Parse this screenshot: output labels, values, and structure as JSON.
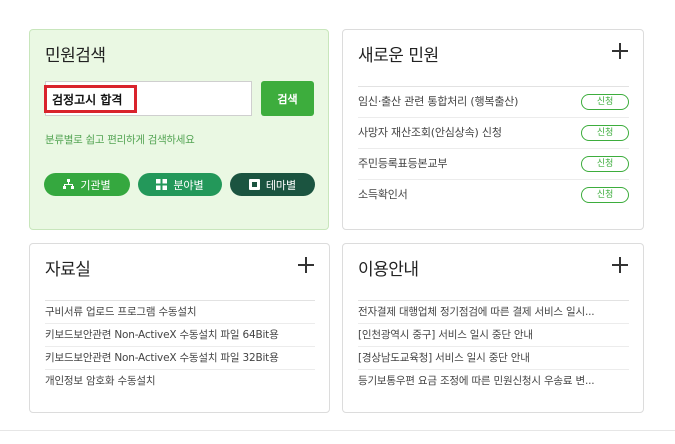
{
  "search": {
    "title": "민원검색",
    "input_value": "검정고시 합격",
    "button_label": "검색",
    "hint": "분류별로 쉽고 편리하게 검색하세요",
    "filters": [
      {
        "label": "기관별",
        "icon": "org-chart-icon"
      },
      {
        "label": "분야별",
        "icon": "grid-icon"
      },
      {
        "label": "테마별",
        "icon": "theme-icon"
      }
    ]
  },
  "new_services": {
    "title": "새로운 민원",
    "items": [
      {
        "label": "임신·출산 관련 통합처리 (행복출산)",
        "badge": "신청"
      },
      {
        "label": "사망자 재산조회(안심상속) 신청",
        "badge": "신청"
      },
      {
        "label": "주민등록표등본교부",
        "badge": "신청"
      },
      {
        "label": "소득확인서",
        "badge": "신청"
      }
    ]
  },
  "downloads": {
    "title": "자료실",
    "items": [
      "구비서류 업로드 프로그램 수동설치",
      "키보드보안관련 Non-ActiveX 수동설치 파일 64Bit용",
      "키보드보안관련 Non-ActiveX 수동설치 파일 32Bit용",
      "개인정보 암호화 수동설치"
    ]
  },
  "guide": {
    "title": "이용안내",
    "items": [
      "전자결제 대행업체 정기점검에 따른 결제 서비스 일시...",
      "[인천광역시 중구] 서비스 일시 중단 안내",
      "[경상남도교육청] 서비스 일시 중단 안내",
      "등기보통우편 요금 조정에 따른 민원신청시 우송료 변..."
    ]
  },
  "colors": {
    "accent_green": "#3dad3d",
    "search_bg": "#eaf8e3",
    "highlight_red": "#d9232c",
    "pill_org": "#35a83f",
    "pill_field": "#23985a",
    "pill_theme": "#1b5440"
  }
}
